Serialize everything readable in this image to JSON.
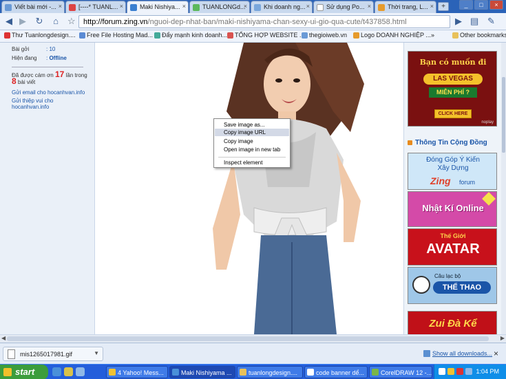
{
  "browser": {
    "tabs": [
      {
        "title": "Viết bài mới -..."
      },
      {
        "title": "[----* TUANL..."
      },
      {
        "title": "Maki Nishiya..."
      },
      {
        "title": "TUANLONGd..."
      },
      {
        "title": "Khi doanh ng..."
      },
      {
        "title": "Sử dụng Po..."
      },
      {
        "title": "Thời trang, L..."
      }
    ],
    "new_tab_label": "+",
    "close_glyph": "×",
    "url_domain": "http://forum.zing.vn",
    "url_path": "/nguoi-dep-nhat-ban/maki-nishiyama-chan-sexy-ui-gio-qua-cute/t437858.html",
    "bookmarks": [
      {
        "label": "Thư Tuanlongdesign...."
      },
      {
        "label": "Free File Hosting Mad..."
      },
      {
        "label": "Đẩy mạnh kinh doanh..."
      },
      {
        "label": "TỔNG HỢP WEBSITE ...."
      },
      {
        "label": "thegioiweb.vn"
      },
      {
        "label": "Logo DOANH NGHIỆP ..."
      }
    ],
    "other_bookmarks": "Other bookmarks",
    "bookmarks_overflow": "»"
  },
  "left_panel": {
    "posts_label": "Bài gởi",
    "posts_value": ": 10",
    "status_label": "Hiện đang",
    "status_value": "Offline",
    "thanks_prefix": "Đã được cám ơn",
    "thanks_count": "17",
    "thanks_mid": "lần trong",
    "thanks_posts": "8",
    "thanks_suffix": "bài viết",
    "email_link": "Gửi email cho hocanhvan.info",
    "fun_link": "Gửi thiệp vui cho hocanhvan.info"
  },
  "right_panel": {
    "vegas_ad": {
      "line1": "Bạn có muốn đi",
      "line2": "LAS VEGAS",
      "line3": "MIỄN PHÍ ?",
      "cta": "CLICK HERE",
      "brand": "noplay"
    },
    "heading": "Thông Tin Cộng Đồng",
    "zing_ad": {
      "line1": "Đóng Góp Ý Kiến",
      "line2": "Xây Dựng",
      "brand": "Zing",
      "sub": "forum"
    },
    "nhatki_ad": {
      "text": "Nhật Kí Online"
    },
    "avatar_ad": {
      "line1": "Thế Giới",
      "line2": "AVATAR"
    },
    "thethao_ad": {
      "line1": "Câu lạc bộ",
      "line2": "THẾ THAO"
    },
    "last_ad": {
      "text": "Zui Đà Kể"
    }
  },
  "context_menu": {
    "items": [
      "Save image as...",
      "Copy image URL",
      "Copy image",
      "Open image in new tab"
    ],
    "inspect": "Inspect element",
    "highlighted_index": 1
  },
  "downloads": {
    "file_name": "mis1265017981.gif",
    "show_all": "Show all downloads...",
    "close": "×"
  },
  "taskbar": {
    "start": "start",
    "tasks": [
      {
        "label": "4 Yahoo! Mess..."
      },
      {
        "label": "Maki Nishiyama ..."
      },
      {
        "label": "tuanlongdesign...."
      },
      {
        "label": "code banner dể..."
      },
      {
        "label": "CorelDRAW 12 -..."
      }
    ],
    "clock": "1:04 PM"
  },
  "colors": {
    "link": "#1a55a8",
    "accent_red": "#d22",
    "taskbar": "#245edb",
    "start": "#3c9d3c"
  }
}
